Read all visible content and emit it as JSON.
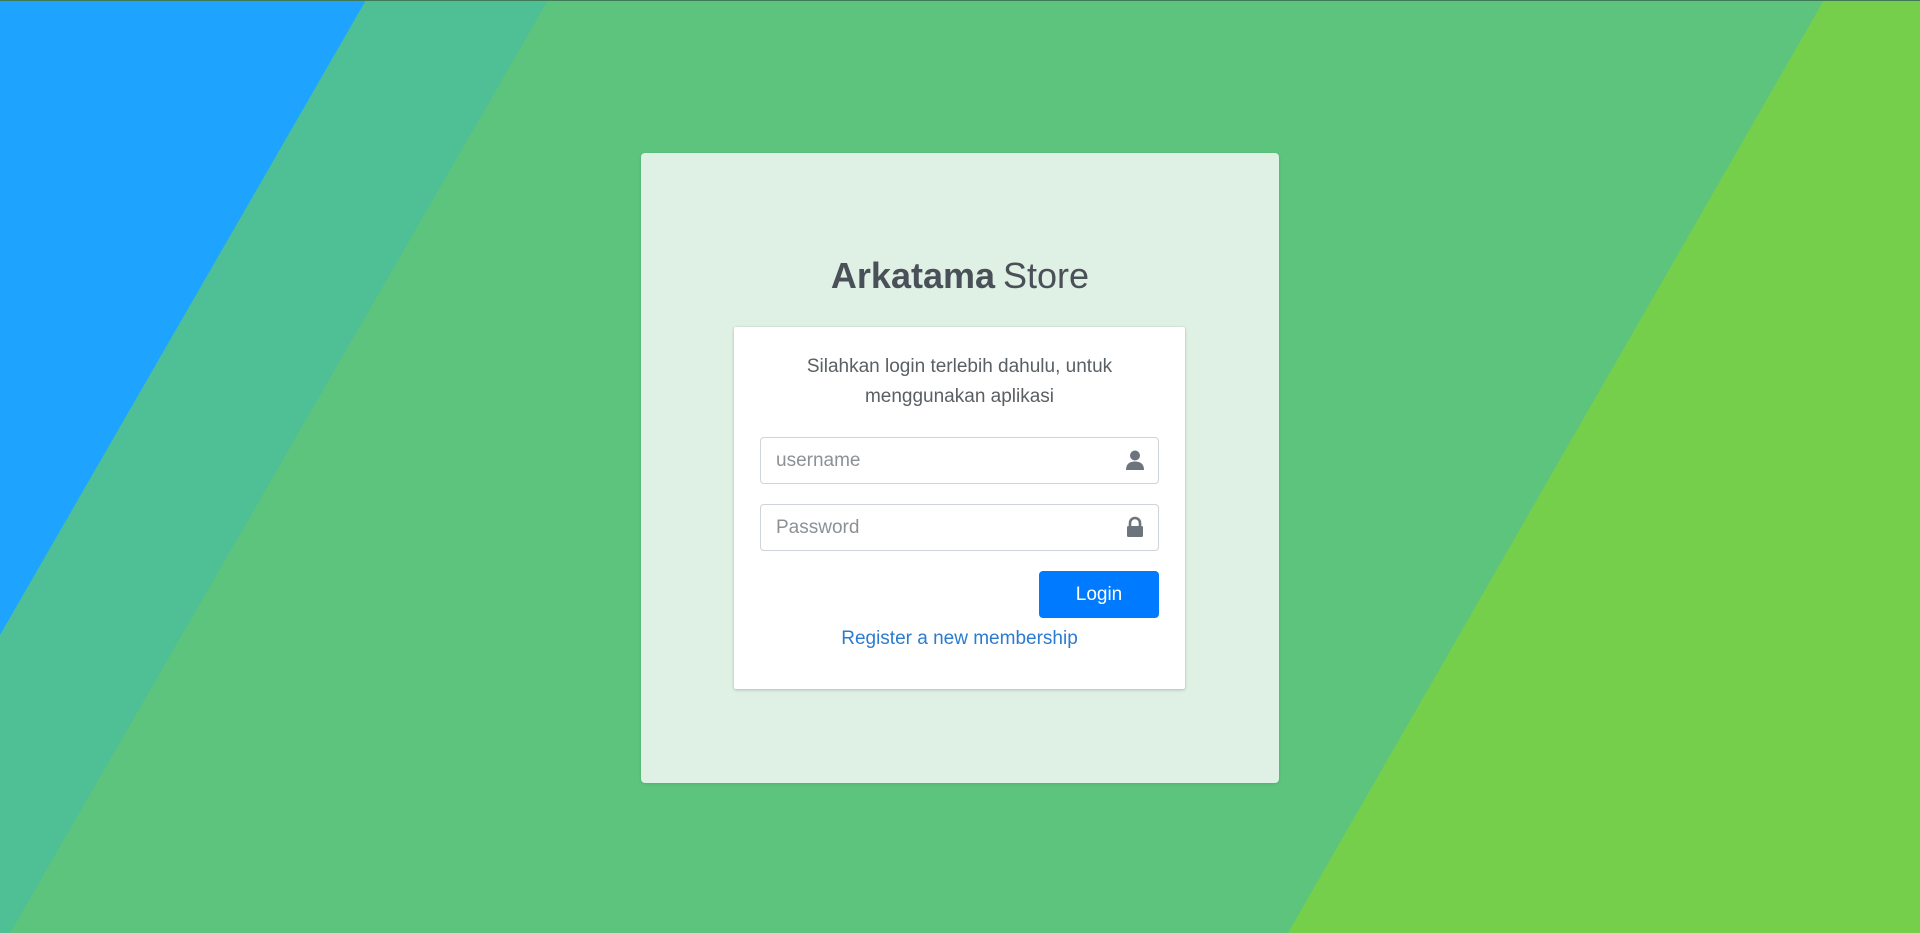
{
  "brand": {
    "bold": "Arkatama",
    "light": "Store"
  },
  "login_box": {
    "message_line1": "Silahkan login terlebih dahulu, untuk",
    "message_line2": "menggunakan aplikasi",
    "username": {
      "placeholder": "username",
      "value": "",
      "icon": "user-icon"
    },
    "password": {
      "placeholder": "Password",
      "value": "",
      "icon": "lock-icon"
    },
    "login_label": "Login",
    "register_label": "Register a new membership"
  },
  "colors": {
    "background_blue": "#1ea4ff",
    "background_teal": "#4fbf95",
    "background_green": "#5dc47d",
    "background_lime": "#75cf4b",
    "outer_card": "#dff0e5",
    "primary": "#007bff",
    "link": "#2b7bd1"
  }
}
